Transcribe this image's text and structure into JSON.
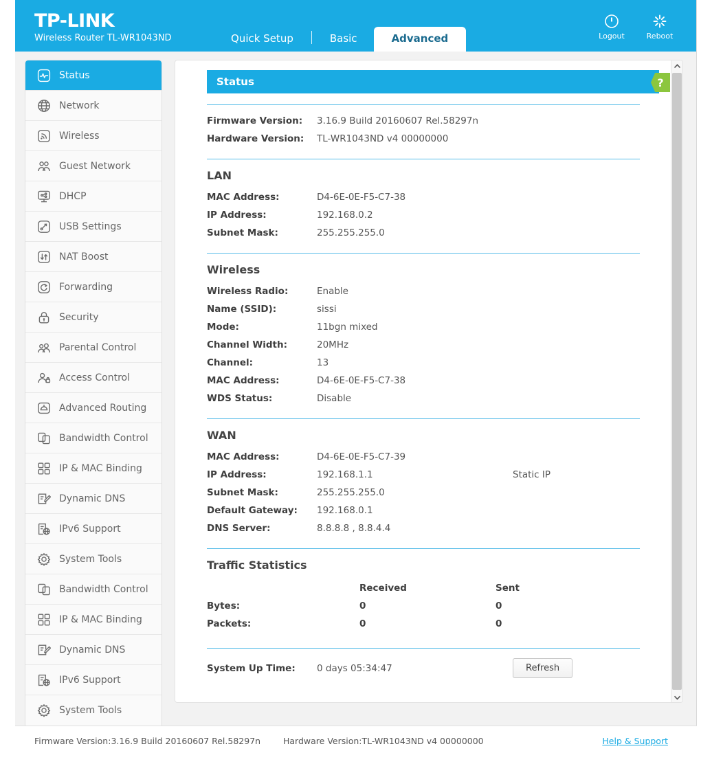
{
  "header": {
    "logo": "TP-LINK",
    "subtitle": "Wireless Router TL-WR1043ND",
    "tabs": [
      {
        "label": "Quick Setup",
        "active": false
      },
      {
        "label": "Basic",
        "active": false
      },
      {
        "label": "Advanced",
        "active": true
      }
    ],
    "actions": [
      {
        "label": "Logout",
        "icon": "power-icon"
      },
      {
        "label": "Reboot",
        "icon": "reboot-icon"
      }
    ]
  },
  "sidebar": {
    "items": [
      {
        "label": "Status",
        "icon": "status-icon",
        "active": true
      },
      {
        "label": "Network",
        "icon": "globe-icon",
        "active": false
      },
      {
        "label": "Wireless",
        "icon": "wireless-icon",
        "active": false
      },
      {
        "label": "Guest Network",
        "icon": "guest-network-icon",
        "active": false
      },
      {
        "label": "DHCP",
        "icon": "dhcp-icon",
        "active": false
      },
      {
        "label": "USB Settings",
        "icon": "usb-icon",
        "active": false
      },
      {
        "label": "NAT Boost",
        "icon": "nat-boost-icon",
        "active": false
      },
      {
        "label": "Forwarding",
        "icon": "forwarding-icon",
        "active": false
      },
      {
        "label": "Security",
        "icon": "lock-icon",
        "active": false
      },
      {
        "label": "Parental Control",
        "icon": "parental-control-icon",
        "active": false
      },
      {
        "label": "Access Control",
        "icon": "access-control-icon",
        "active": false
      },
      {
        "label": "Advanced Routing",
        "icon": "advanced-routing-icon",
        "active": false
      },
      {
        "label": "Bandwidth Control",
        "icon": "bandwidth-control-icon",
        "active": false
      },
      {
        "label": "IP & MAC Binding",
        "icon": "ip-mac-binding-icon",
        "active": false
      },
      {
        "label": "Dynamic DNS",
        "icon": "dynamic-dns-icon",
        "active": false
      },
      {
        "label": "IPv6 Support",
        "icon": "ipv6-icon",
        "active": false
      },
      {
        "label": "System Tools",
        "icon": "gear-icon",
        "active": false
      },
      {
        "label": "Bandwidth Control",
        "icon": "bandwidth-control-icon",
        "active": false
      },
      {
        "label": "IP & MAC Binding",
        "icon": "ip-mac-binding-icon",
        "active": false
      },
      {
        "label": "Dynamic DNS",
        "icon": "dynamic-dns-icon",
        "active": false
      },
      {
        "label": "IPv6 Support",
        "icon": "ipv6-icon",
        "active": false
      },
      {
        "label": "System Tools",
        "icon": "gear-icon",
        "active": false
      }
    ]
  },
  "content": {
    "pane_title": "Status",
    "help_label": "?",
    "version": {
      "rows": [
        {
          "key": "Firmware Version:",
          "value": "3.16.9 Build 20160607 Rel.58297n"
        },
        {
          "key": "Hardware Version:",
          "value": "TL-WR1043ND v4 00000000"
        }
      ]
    },
    "lan": {
      "title": "LAN",
      "rows": [
        {
          "key": "MAC Address:",
          "value": "D4-6E-0E-F5-C7-38"
        },
        {
          "key": "IP Address:",
          "value": "192.168.0.2"
        },
        {
          "key": "Subnet Mask:",
          "value": "255.255.255.0"
        }
      ]
    },
    "wireless": {
      "title": "Wireless",
      "rows": [
        {
          "key": "Wireless Radio:",
          "value": "Enable"
        },
        {
          "key": "Name (SSID):",
          "value": "sissi"
        },
        {
          "key": "Mode:",
          "value": "11bgn mixed"
        },
        {
          "key": "Channel Width:",
          "value": "20MHz"
        },
        {
          "key": "Channel:",
          "value": "13"
        },
        {
          "key": "MAC Address:",
          "value": "D4-6E-0E-F5-C7-38"
        },
        {
          "key": "WDS Status:",
          "value": "Disable"
        }
      ]
    },
    "wan": {
      "title": "WAN",
      "rows": [
        {
          "key": "MAC Address:",
          "value": "D4-6E-0E-F5-C7-39",
          "extra": ""
        },
        {
          "key": "IP Address:",
          "value": "192.168.1.1",
          "extra": "Static IP"
        },
        {
          "key": "Subnet Mask:",
          "value": "255.255.255.0",
          "extra": ""
        },
        {
          "key": "Default Gateway:",
          "value": "192.168.0.1",
          "extra": ""
        },
        {
          "key": "DNS Server:",
          "value": "8.8.8.8 , 8.8.4.4",
          "extra": ""
        }
      ]
    },
    "traffic": {
      "title": "Traffic Statistics",
      "col_blank": "",
      "col_received": "Received",
      "col_sent": "Sent",
      "rows": [
        {
          "key": "Bytes:",
          "received": "0",
          "sent": "0"
        },
        {
          "key": "Packets:",
          "received": "0",
          "sent": "0"
        }
      ]
    },
    "uptime": {
      "key": "System Up Time:",
      "value": "0 days 05:34:47",
      "refresh_label": "Refresh"
    }
  },
  "footer": {
    "firmware": "Firmware Version:3.16.9 Build 20160607 Rel.58297n",
    "hardware": "Hardware Version:TL-WR1043ND v4 00000000",
    "help": "Help & Support"
  },
  "colors": {
    "brand_blue": "#1aabe3",
    "help_green": "#8cc63e",
    "rule_blue": "#56bce8"
  }
}
